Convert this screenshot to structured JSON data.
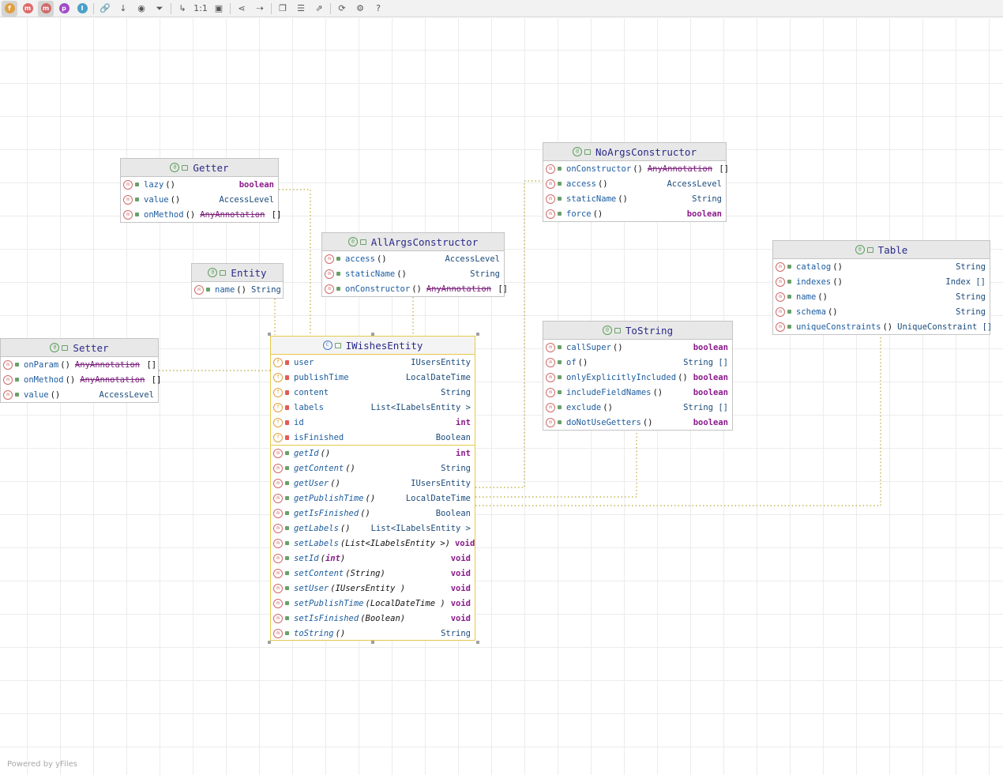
{
  "toolbar": {
    "buttons": [
      {
        "name": "fields-filter",
        "glyph": "f",
        "color": "#e0a040",
        "active": true
      },
      {
        "name": "constructors-filter",
        "glyph": "m",
        "color": "#e06a6a",
        "active": false
      },
      {
        "name": "methods-filter",
        "glyph": "m",
        "color": "#d06a6a",
        "active": true
      },
      {
        "name": "properties-filter",
        "glyph": "p",
        "color": "#a04ac8",
        "active": false
      },
      {
        "name": "inner-classes-filter",
        "glyph": "I",
        "color": "#4aa0c8",
        "active": false
      },
      {
        "name": "dependencies",
        "glyph": "🔗",
        "active": false
      },
      {
        "name": "sort",
        "glyph": "↓",
        "active": false
      },
      {
        "name": "visibility",
        "glyph": "◉",
        "active": false
      },
      {
        "name": "filter",
        "glyph": "⏷",
        "active": false
      },
      {
        "name": "edge",
        "glyph": "↳",
        "active": false
      },
      {
        "name": "actual-size",
        "glyph": "1:1",
        "active": false
      },
      {
        "name": "fit-content",
        "glyph": "▣",
        "active": false
      },
      {
        "name": "share",
        "glyph": "⋖",
        "active": false
      },
      {
        "name": "navigate",
        "glyph": "⇢",
        "active": false
      },
      {
        "name": "copy",
        "glyph": "❐",
        "active": false
      },
      {
        "name": "layout",
        "glyph": "☰",
        "active": false
      },
      {
        "name": "export",
        "glyph": "⇗",
        "active": false
      },
      {
        "name": "refresh",
        "glyph": "⟳",
        "active": false
      },
      {
        "name": "settings",
        "glyph": "⚙",
        "active": false
      },
      {
        "name": "help",
        "glyph": "?",
        "active": false
      }
    ]
  },
  "nodes": {
    "getter": {
      "title": "Getter",
      "rows": [
        {
          "name": "lazy",
          "params": "()",
          "type": "boolean"
        },
        {
          "name": "value",
          "params": "()",
          "type": "AccessLevel"
        },
        {
          "name": "onMethod",
          "params": "()",
          "type": "AnyAnnotation []"
        }
      ]
    },
    "noargs": {
      "title": "NoArgsConstructor",
      "rows": [
        {
          "name": "onConstructor",
          "params": "()",
          "type": "AnyAnnotation []"
        },
        {
          "name": "access",
          "params": "()",
          "type": "AccessLevel"
        },
        {
          "name": "staticName",
          "params": "()",
          "type": "String"
        },
        {
          "name": "force",
          "params": "()",
          "type": "boolean"
        }
      ]
    },
    "allargs": {
      "title": "AllArgsConstructor",
      "rows": [
        {
          "name": "access",
          "params": "()",
          "type": "AccessLevel"
        },
        {
          "name": "staticName",
          "params": "()",
          "type": "String"
        },
        {
          "name": "onConstructor",
          "params": "()",
          "type": "AnyAnnotation []"
        }
      ]
    },
    "entity": {
      "title": "Entity",
      "rows": [
        {
          "name": "name",
          "params": "()",
          "type": "String"
        }
      ]
    },
    "table": {
      "title": "Table",
      "rows": [
        {
          "name": "catalog",
          "params": "()",
          "type": "String"
        },
        {
          "name": "indexes",
          "params": "()",
          "type": "Index []"
        },
        {
          "name": "name",
          "params": "()",
          "type": "String"
        },
        {
          "name": "schema",
          "params": "()",
          "type": "String"
        },
        {
          "name": "uniqueConstraints",
          "params": "()",
          "type": "UniqueConstraint []"
        }
      ]
    },
    "setter": {
      "title": "Setter",
      "rows": [
        {
          "name": "onParam",
          "params": "()",
          "type": "AnyAnnotation []"
        },
        {
          "name": "onMethod",
          "params": "()",
          "type": "AnyAnnotation []"
        },
        {
          "name": "value",
          "params": "()",
          "type": "AccessLevel"
        }
      ]
    },
    "tostring": {
      "title": "ToString",
      "rows": [
        {
          "name": "callSuper",
          "params": "()",
          "type": "boolean"
        },
        {
          "name": "of",
          "params": "()",
          "type": "String []"
        },
        {
          "name": "onlyExplicitlyIncluded",
          "params": "()",
          "type": "boolean"
        },
        {
          "name": "includeFieldNames",
          "params": "()",
          "type": "boolean"
        },
        {
          "name": "exclude",
          "params": "()",
          "type": "String []"
        },
        {
          "name": "doNotUseGetters",
          "params": "()",
          "type": "boolean"
        }
      ]
    },
    "iwishes": {
      "title": "IWishesEntity",
      "fields": [
        {
          "name": "user",
          "type": "IUsersEntity"
        },
        {
          "name": "publishTime",
          "type": "LocalDateTime"
        },
        {
          "name": "content",
          "type": "String"
        },
        {
          "name": "labels",
          "type": "List<ILabelsEntity >"
        },
        {
          "name": "id",
          "type": "int"
        },
        {
          "name": "isFinished",
          "type": "Boolean"
        }
      ],
      "methods": [
        {
          "name": "getId",
          "params": "()",
          "type": "int"
        },
        {
          "name": "getContent",
          "params": "()",
          "type": "String"
        },
        {
          "name": "getUser",
          "params": "()",
          "type": "IUsersEntity"
        },
        {
          "name": "getPublishTime",
          "params": "()",
          "type": "LocalDateTime"
        },
        {
          "name": "getIsFinished",
          "params": "()",
          "type": "Boolean"
        },
        {
          "name": "getLabels",
          "params": "()",
          "type": "List<ILabelsEntity >"
        },
        {
          "name": "setLabels",
          "params": "(List<ILabelsEntity >)",
          "type": "void"
        },
        {
          "name": "setId",
          "params": "(int)",
          "type": "void"
        },
        {
          "name": "setContent",
          "params": "(String)",
          "type": "void"
        },
        {
          "name": "setUser",
          "params": "(IUsersEntity )",
          "type": "void"
        },
        {
          "name": "setPublishTime",
          "params": "(LocalDateTime )",
          "type": "void"
        },
        {
          "name": "setIsFinished",
          "params": "(Boolean)",
          "type": "void"
        },
        {
          "name": "toString",
          "params": "()",
          "type": "String"
        }
      ]
    }
  },
  "footer": {
    "text": "Powered by yFiles"
  },
  "colors": {
    "edge": "#b8a832",
    "selection": "#e6c84a",
    "header": "#2a2a8a"
  }
}
